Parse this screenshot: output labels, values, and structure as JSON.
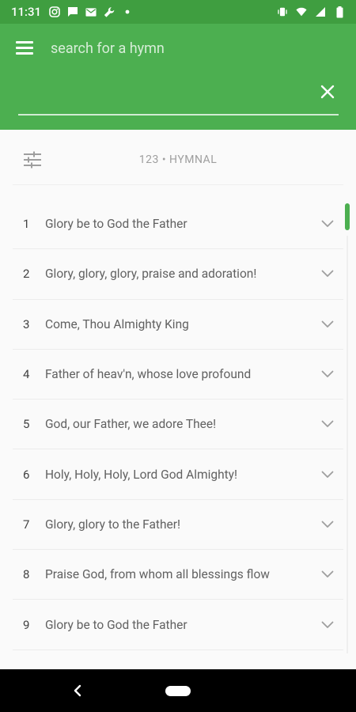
{
  "status_bar": {
    "time": "11:31",
    "icons_left": [
      "instagram-icon",
      "message-icon",
      "mail-icon",
      "wrench-icon",
      "dot-icon"
    ],
    "icons_right": [
      "vibrate-icon",
      "wifi-icon",
      "signal-icon",
      "battery-icon"
    ]
  },
  "search": {
    "placeholder": "search for a hymn",
    "value": ""
  },
  "filter": {
    "label": "123 • HYMNAL"
  },
  "hymns": [
    {
      "number": "1",
      "title": "Glory be to God the Father"
    },
    {
      "number": "2",
      "title": "Glory, glory, glory, praise and adoration!"
    },
    {
      "number": "3",
      "title": "Come, Thou Almighty King"
    },
    {
      "number": "4",
      "title": "Father of heav'n, whose love profound"
    },
    {
      "number": "5",
      "title": "God, our Father, we adore Thee!"
    },
    {
      "number": "6",
      "title": "Holy, Holy, Holy, Lord God Almighty!"
    },
    {
      "number": "7",
      "title": "Glory, glory to the Father!"
    },
    {
      "number": "8",
      "title": "Praise God, from whom all blessings flow"
    },
    {
      "number": "9",
      "title": "Glory be to God the Father"
    }
  ],
  "colors": {
    "accent": "#4caf50",
    "status_bar": "#3f9e40"
  }
}
